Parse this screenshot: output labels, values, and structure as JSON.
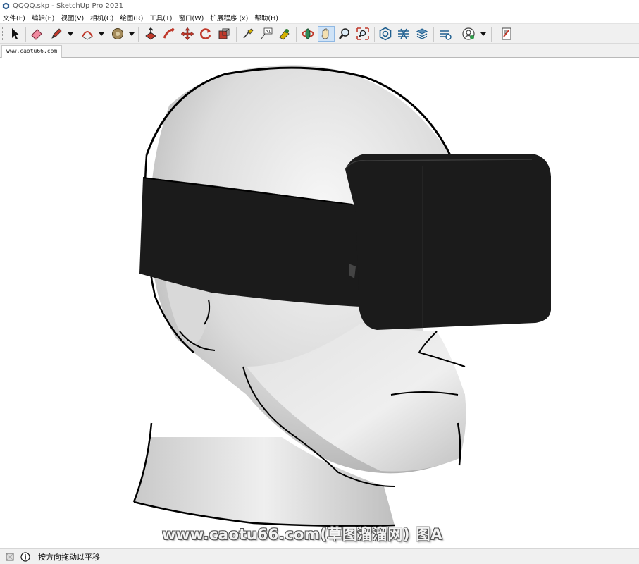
{
  "window": {
    "title": "QQQQ.skp - SketchUp Pro 2021"
  },
  "menu": [
    "文件(F)",
    "编辑(E)",
    "视图(V)",
    "相机(C)",
    "绘图(R)",
    "工具(T)",
    "窗口(W)",
    "扩展程序 (x)",
    "帮助(H)"
  ],
  "toolbar": {
    "tools": [
      "select-icon",
      "eraser-icon",
      "pencil-icon",
      "arc-icon",
      "push-pull-icon",
      "paint-bucket-icon",
      "follow-me-icon",
      "move-icon",
      "rotate-icon",
      "scale-icon",
      "tape-measure-icon",
      "text-icon",
      "paint-icon",
      "orbit-icon",
      "pan-icon",
      "zoom-icon",
      "zoom-extents-icon",
      "warehouse-icon",
      "extension-warehouse-icon",
      "layout-icon",
      "extension-manager-icon",
      "account-icon",
      "model-info-icon"
    ],
    "active_tool": "pan-icon"
  },
  "scene_tab": {
    "label": "www.caotu66.com"
  },
  "watermark": {
    "text": "www.caotu66.com(草图溜溜网) 图A"
  },
  "statusbar": {
    "message": "按方向拖动以平移"
  },
  "colors": {
    "headset": "#1b1b1b",
    "head_light": "#ececec",
    "head_shadow": "#b5b5b5",
    "outline": "#000000",
    "active_tool_bg": "#cfe3f7"
  }
}
